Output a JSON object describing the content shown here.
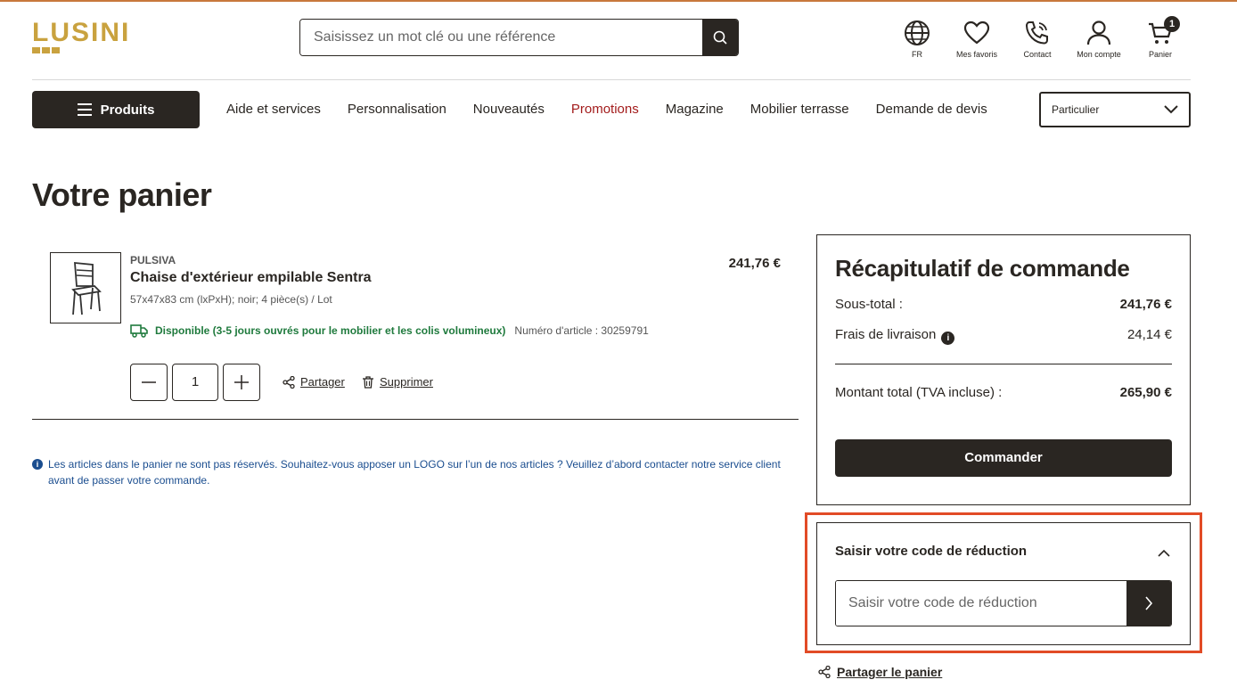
{
  "header": {
    "logo_text": "LUSINI",
    "search_placeholder": "Saisissez un mot clé ou une référence",
    "icons": [
      {
        "name": "globe-icon",
        "label": "FR"
      },
      {
        "name": "heart-icon",
        "label": "Mes favoris"
      },
      {
        "name": "phone-icon",
        "label": "Contact"
      },
      {
        "name": "user-icon",
        "label": "Mon compte"
      },
      {
        "name": "cart-icon",
        "label": "Panier",
        "badge": "1"
      }
    ]
  },
  "nav": {
    "products_label": "Produits",
    "items": [
      "Aide et services",
      "Personnalisation",
      "Nouveautés",
      "Promotions",
      "Magazine",
      "Mobilier terrasse",
      "Demande de devis"
    ],
    "customer_type": "Particulier"
  },
  "page": {
    "title": "Votre panier"
  },
  "cart_item": {
    "brand": "PULSIVA",
    "name": "Chaise d'extérieur empilable Sentra",
    "description": "57x47x83 cm (lxPxH); noir; 4 pièce(s) / Lot",
    "availability": "Disponible (3-5 jours ouvrés pour le mobilier et les colis volumineux)",
    "article_number": "Numéro d'article : 30259791",
    "price": "241,76 €",
    "quantity": "1",
    "share_label": "Partager",
    "delete_label": "Supprimer"
  },
  "notice": "Les articles dans le panier ne sont pas réservés. Souhaitez-vous apposer un LOGO sur l’un de nos articles ? Veuillez d’abord contacter notre service client avant de passer votre commande.",
  "summary": {
    "title": "Récapitulatif de commande",
    "subtotal_label": "Sous-total :",
    "subtotal_value": "241,76 €",
    "shipping_label": "Frais de livraison",
    "shipping_value": "24,14 €",
    "total_label": "Montant total (TVA incluse) :",
    "total_value": "265,90 €",
    "order_button": "Commander"
  },
  "promo": {
    "title": "Saisir votre code de réduction",
    "placeholder": "Saisir votre code de réduction"
  },
  "share_cart_label": "Partager le panier",
  "colors": {
    "brand_gold": "#c9a23f",
    "dark": "#2a2622",
    "promo_red": "#a31c1c",
    "available_green": "#1f7a3d",
    "highlight": "#e24b26"
  }
}
